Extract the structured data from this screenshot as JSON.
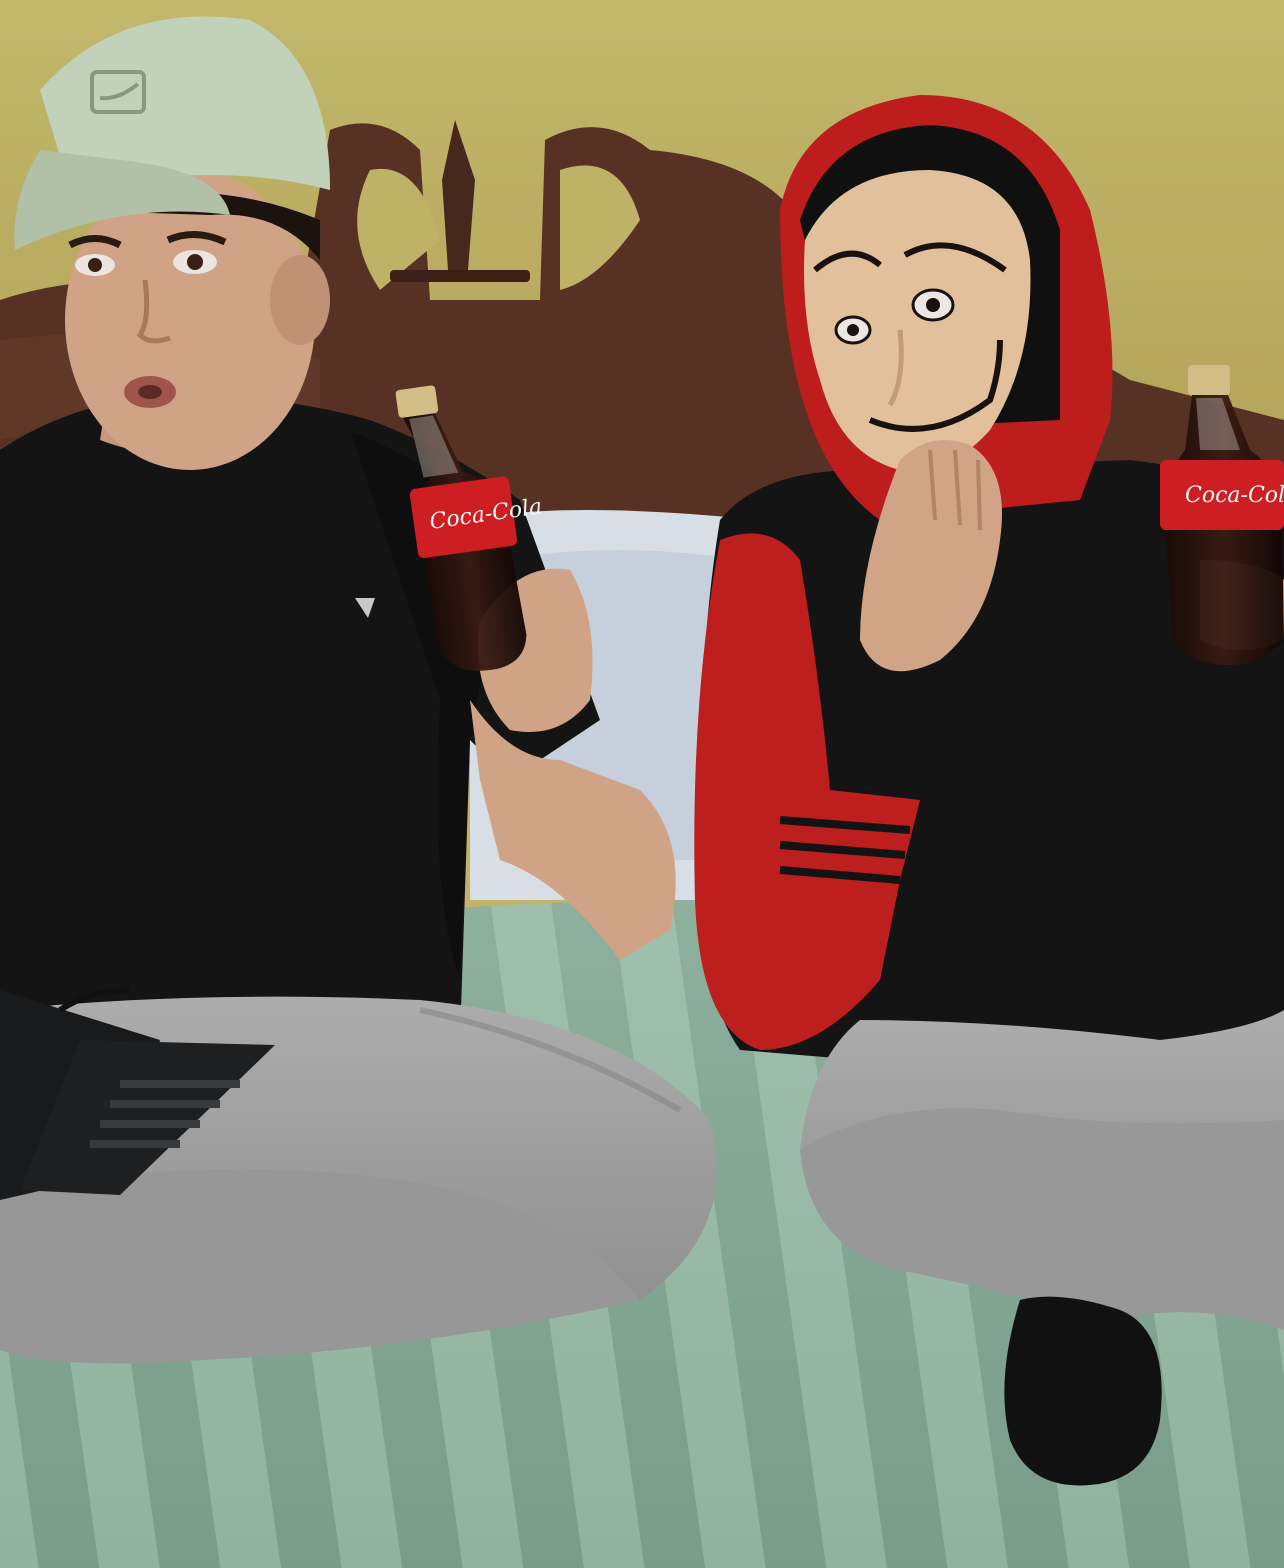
{
  "photo": {
    "bottle_brand_left": "Coca-Cola",
    "bottle_brand_right": "Coca-Cola"
  },
  "palette": {
    "wall": "#c8bb6c",
    "headboard": "#5a3426",
    "bedspread": "#8fb3a0",
    "cap": "#c9d8bf",
    "shirt": "#141414",
    "pants": "#a9a9a9",
    "hoodie_red": "#c41f1f",
    "mask": "#e9c7a1",
    "coke_red": "#d41f26",
    "coke_dark": "#2a1410"
  }
}
